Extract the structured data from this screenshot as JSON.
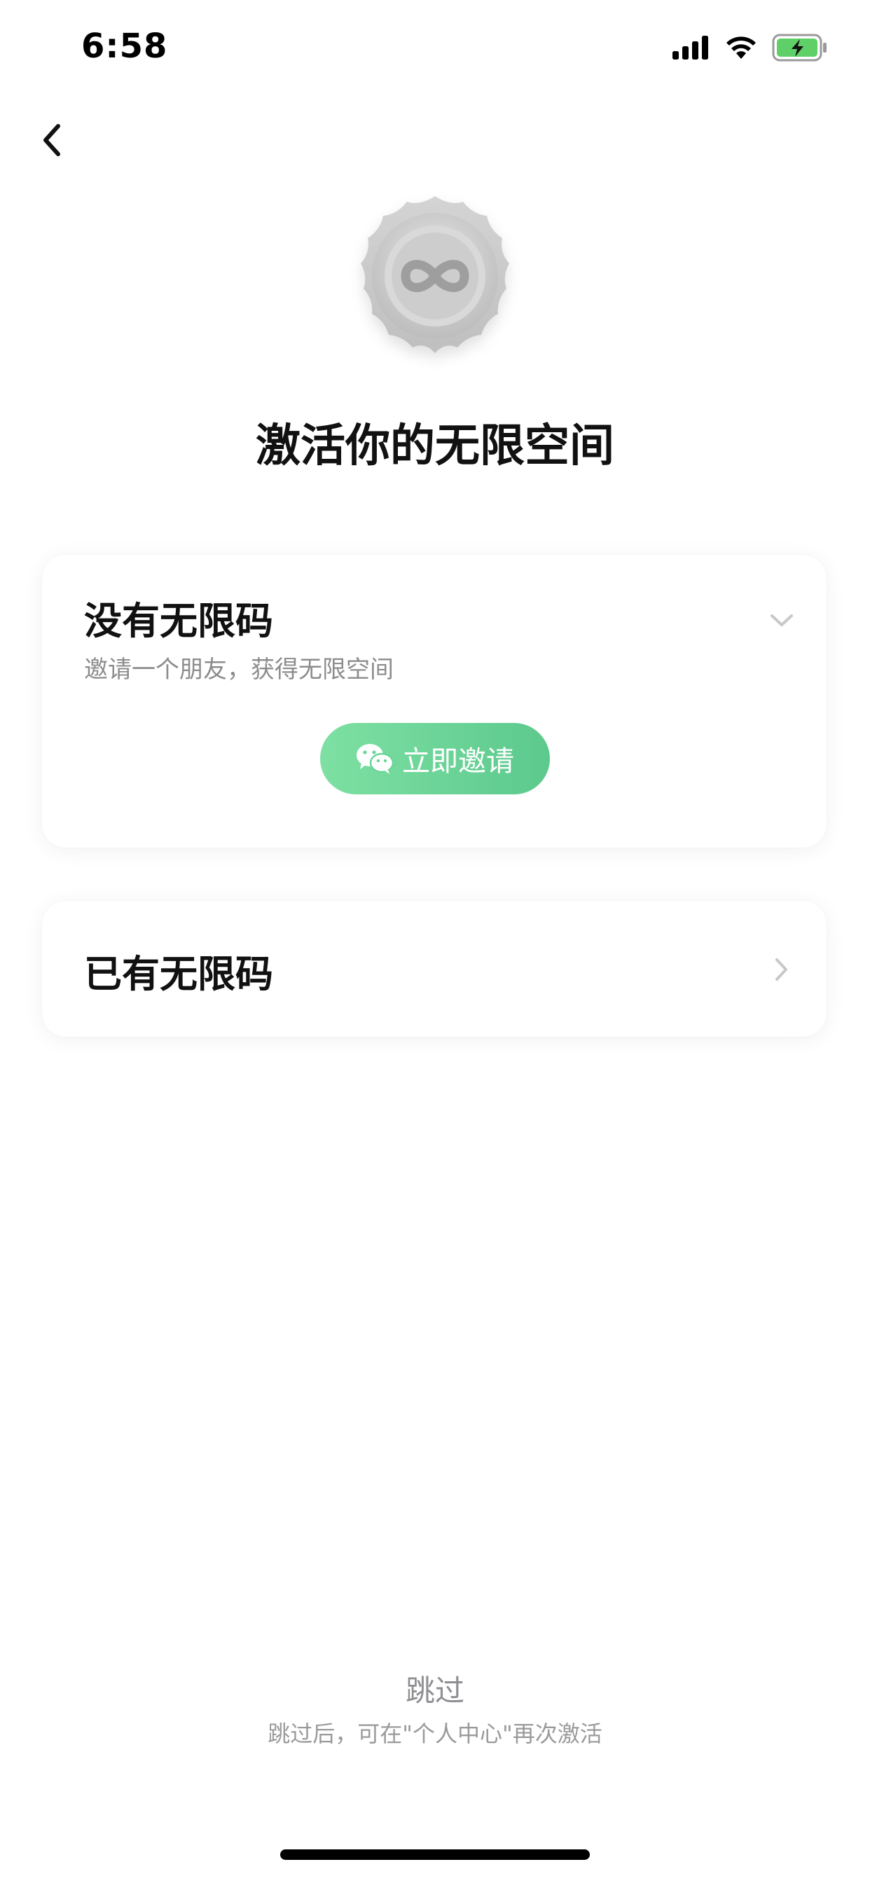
{
  "status_bar": {
    "time": "6:58",
    "icons": [
      "signal-icon",
      "wifi-icon",
      "battery-charging-icon"
    ],
    "battery_color": "#5fd068"
  },
  "nav": {
    "back_icon": "chevron-left-icon"
  },
  "hero": {
    "badge_icon": "infinity-badge-icon",
    "title": "激活你的无限空间"
  },
  "invite_card": {
    "title": "没有无限码",
    "subtitle": "邀请一个朋友，获得无限空间",
    "chevron_icon": "chevron-down-icon",
    "button_icon": "wechat-icon",
    "button_label": "立即邀请",
    "button_color": "#6ad699"
  },
  "code_card": {
    "title": "已有无限码",
    "chevron_icon": "chevron-right-icon"
  },
  "footer": {
    "skip_label": "跳过",
    "skip_hint": "跳过后，可在\"个人中心\"再次激活"
  }
}
